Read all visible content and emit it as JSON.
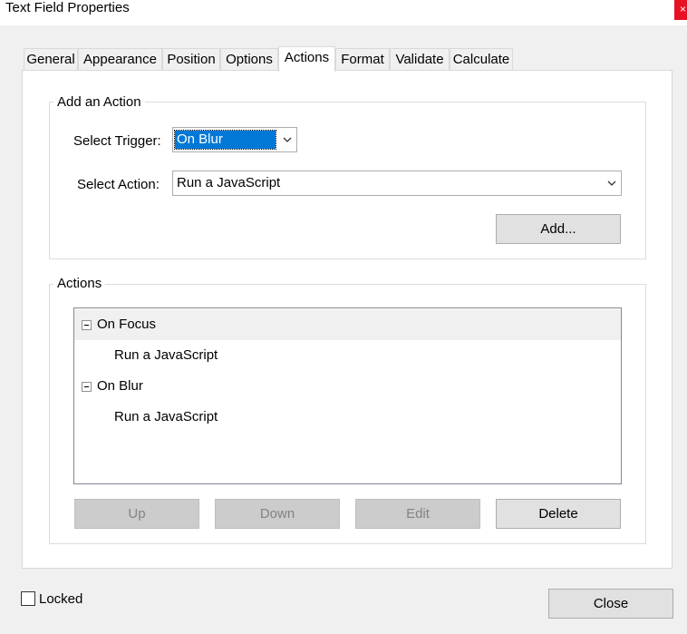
{
  "window": {
    "title": "Text Field Properties",
    "close_glyph": "×"
  },
  "tabs": [
    {
      "label": "General"
    },
    {
      "label": "Appearance"
    },
    {
      "label": "Position"
    },
    {
      "label": "Options"
    },
    {
      "label": "Actions",
      "active": true
    },
    {
      "label": "Format"
    },
    {
      "label": "Validate"
    },
    {
      "label": "Calculate"
    }
  ],
  "add_action": {
    "group_label": "Add an Action",
    "trigger_label": "Select Trigger:",
    "trigger_value": "On Blur",
    "action_label": "Select Action:",
    "action_value": "Run a JavaScript",
    "add_button": "Add..."
  },
  "actions": {
    "group_label": "Actions",
    "tree": [
      {
        "trigger": "On Focus",
        "action": "Run a JavaScript"
      },
      {
        "trigger": "On Blur",
        "action": "Run a JavaScript"
      }
    ],
    "buttons": {
      "up": "Up",
      "down": "Down",
      "edit": "Edit",
      "delete": "Delete"
    }
  },
  "footer": {
    "locked_label": "Locked",
    "locked_checked": false,
    "close_button": "Close"
  },
  "colors": {
    "selection": "#0078d7",
    "close_red": "#e81123"
  }
}
